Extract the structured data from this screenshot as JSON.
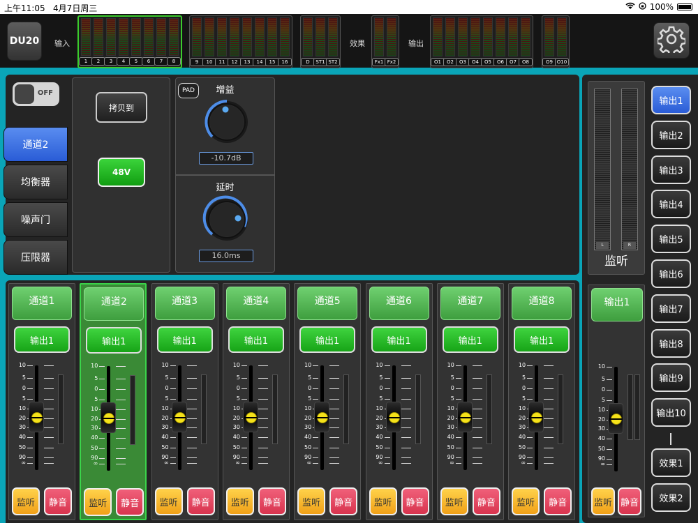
{
  "status": {
    "time": "上午11:05",
    "date": "4月7日周三",
    "battery": "100%"
  },
  "topbar": {
    "device": "DU20",
    "input_label": "输入",
    "effects_label": "效果",
    "output_label": "输出",
    "inputs": [
      "1",
      "2",
      "3",
      "4",
      "5",
      "6",
      "7",
      "8"
    ],
    "inputs2": [
      "9",
      "10",
      "11",
      "12",
      "13",
      "14",
      "15",
      "16"
    ],
    "digital": [
      "D",
      "ST1",
      "ST2"
    ],
    "fx": [
      "Fx1",
      "Fx2"
    ],
    "outputs": [
      "O1",
      "O2",
      "O3",
      "O4",
      "O5",
      "O6",
      "O7",
      "O8"
    ],
    "outputs2": [
      "O9",
      "O10"
    ]
  },
  "toggle": {
    "label": "OFF",
    "on": false
  },
  "tabs": [
    {
      "label": "通道2",
      "active": true
    },
    {
      "label": "均衡器",
      "active": false
    },
    {
      "label": "噪声门",
      "active": false
    },
    {
      "label": "压限器",
      "active": false
    }
  ],
  "controls": {
    "copy_label": "拷贝到",
    "phantom_label": "48V",
    "pad_label": "PAD",
    "gain": {
      "title": "增益",
      "value": "-10.7dB"
    },
    "delay": {
      "title": "延时",
      "value": "16.0ms"
    }
  },
  "monitor": {
    "label": "监听",
    "left": "L",
    "right": "R"
  },
  "output_buttons": [
    "输出1",
    "输出2",
    "输出3",
    "输出4",
    "输出5",
    "输出6",
    "输出7",
    "输出8",
    "输出9",
    "输出10"
  ],
  "effect_buttons": [
    "效果1",
    "效果2"
  ],
  "scale_ticks": [
    "10",
    "5",
    "0",
    "5",
    "10",
    "20",
    "30",
    "40",
    "50",
    "90",
    "∞"
  ],
  "strips": [
    {
      "name": "通道1",
      "route": "输出1",
      "monitor": "监听",
      "mute": "静音",
      "active": false
    },
    {
      "name": "通道2",
      "route": "输出1",
      "monitor": "监听",
      "mute": "静音",
      "active": true
    },
    {
      "name": "通道3",
      "route": "输出1",
      "monitor": "监听",
      "mute": "静音",
      "active": false
    },
    {
      "name": "通道4",
      "route": "输出1",
      "monitor": "监听",
      "mute": "静音",
      "active": false
    },
    {
      "name": "通道5",
      "route": "输出1",
      "monitor": "监听",
      "mute": "静音",
      "active": false
    },
    {
      "name": "通道6",
      "route": "输出1",
      "monitor": "监听",
      "mute": "静音",
      "active": false
    },
    {
      "name": "通道7",
      "route": "输出1",
      "monitor": "监听",
      "mute": "静音",
      "active": false
    },
    {
      "name": "通道8",
      "route": "输出1",
      "monitor": "监听",
      "mute": "静音",
      "active": false
    }
  ],
  "master_strip": {
    "name": "输出1",
    "monitor": "监听",
    "mute": "静音"
  }
}
